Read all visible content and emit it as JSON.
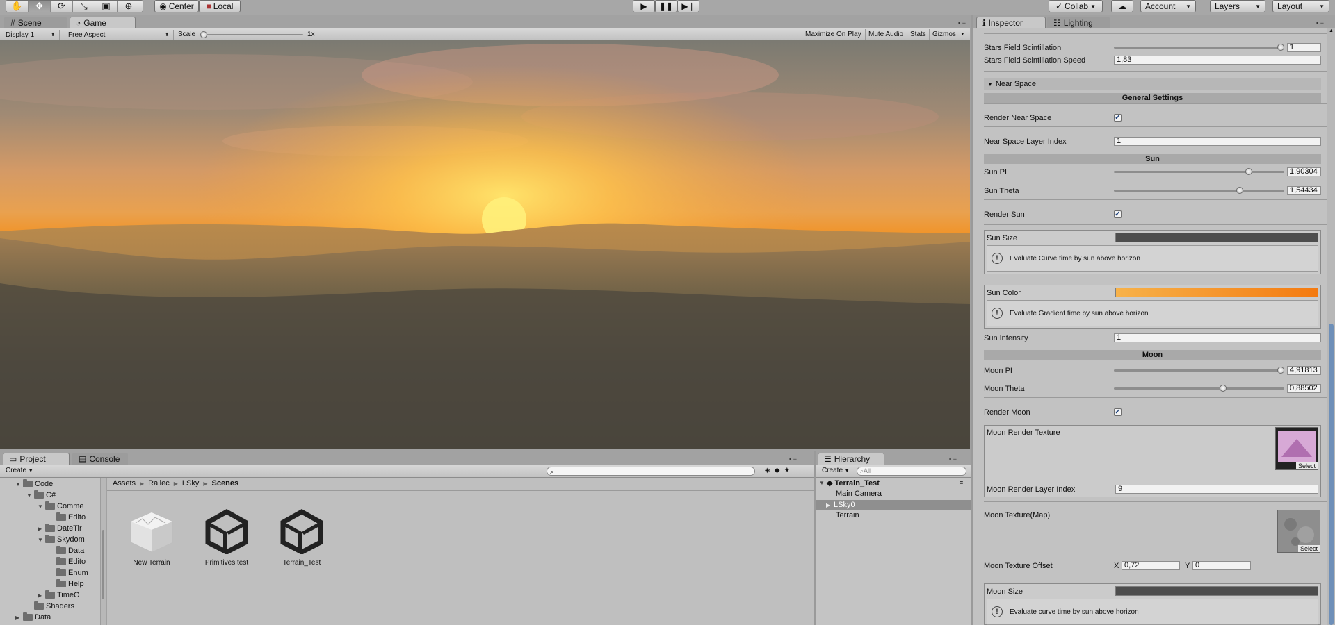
{
  "toolbar": {
    "tools": [
      "hand-icon",
      "move-icon",
      "rotate-icon",
      "scale-icon",
      "rect-icon",
      "transform-icon"
    ],
    "pivot_label": "Center",
    "space_label": "Local",
    "collab_label": "Collab",
    "account_label": "Account",
    "layers_label": "Layers",
    "layout_label": "Layout"
  },
  "view_tabs": {
    "scene": "Scene",
    "game": "Game"
  },
  "game_bar": {
    "display": "Display 1",
    "aspect": "Free Aspect",
    "scale_label": "Scale",
    "scale_value": "1x",
    "maximize": "Maximize On Play",
    "mute": "Mute Audio",
    "stats": "Stats",
    "gizmos": "Gizmos"
  },
  "project": {
    "tab_project": "Project",
    "tab_console": "Console",
    "create": "Create",
    "tree": [
      {
        "label": "Code",
        "indent": 1,
        "arrow": "open"
      },
      {
        "label": "C#",
        "indent": 2,
        "arrow": "open"
      },
      {
        "label": "Comme",
        "indent": 3,
        "arrow": "open"
      },
      {
        "label": "Edito",
        "indent": 4,
        "arrow": ""
      },
      {
        "label": "DateTir",
        "indent": 3,
        "arrow": "closed"
      },
      {
        "label": "Skydom",
        "indent": 3,
        "arrow": "open"
      },
      {
        "label": "Data",
        "indent": 4,
        "arrow": ""
      },
      {
        "label": "Edito",
        "indent": 4,
        "arrow": ""
      },
      {
        "label": "Enum",
        "indent": 4,
        "arrow": ""
      },
      {
        "label": "Help",
        "indent": 4,
        "arrow": ""
      },
      {
        "label": "TimeO",
        "indent": 3,
        "arrow": "closed"
      },
      {
        "label": "Shaders",
        "indent": 2,
        "arrow": ""
      },
      {
        "label": "Data",
        "indent": 1,
        "arrow": "closed"
      }
    ],
    "breadcrumb": [
      "Assets",
      "Rallec",
      "LSky",
      "Scenes"
    ],
    "assets": [
      {
        "name": "New Terrain",
        "icon": "terrain-icon"
      },
      {
        "name": "Primitives test",
        "icon": "unity-scene-icon"
      },
      {
        "name": "Terrain_Test",
        "icon": "unity-scene-icon"
      }
    ]
  },
  "hierarchy": {
    "tab": "Hierarchy",
    "create": "Create",
    "search_placeholder": "All",
    "scene": "Terrain_Test",
    "items": [
      "Main Camera",
      "LSky0",
      "Terrain"
    ]
  },
  "inspector": {
    "tab_inspector": "Inspector",
    "tab_lighting": "Lighting",
    "stars_scintillation": {
      "label": "Stars Field Scintillation",
      "value": "1",
      "fraction": 1.0
    },
    "stars_scintillation_speed": {
      "label": "Stars Field Scintillation Speed",
      "value": "1,83"
    },
    "near_space_foldout": "Near Space",
    "general_settings": "General Settings",
    "render_near_space": "Render Near Space",
    "near_space_layer": {
      "label": "Near Space Layer Index",
      "value": "1"
    },
    "sun_header": "Sun",
    "sun_pi": {
      "label": "Sun PI",
      "value": "1,90304",
      "fraction": 0.79
    },
    "sun_theta": {
      "label": "Sun Theta",
      "value": "1,54434",
      "fraction": 0.74
    },
    "render_sun": "Render Sun",
    "sun_size": "Sun Size",
    "sun_size_help": "Evaluate Curve time by sun above horizon",
    "sun_color": "Sun Color",
    "sun_color_help": "Evaluate Gradient time by sun above horizon",
    "sun_intensity": {
      "label": "Sun Intensity",
      "value": "1"
    },
    "moon_header": "Moon",
    "moon_pi": {
      "label": "Moon PI",
      "value": "4,91813",
      "fraction": 0.98
    },
    "moon_theta": {
      "label": "Moon Theta",
      "value": "0,88502",
      "fraction": 0.64
    },
    "render_moon": "Render Moon",
    "moon_render_texture": "Moon Render Texture",
    "select": "Select",
    "moon_render_layer": {
      "label": "Moon Render Layer Index",
      "value": "9"
    },
    "moon_texture": "Moon Texture(Map)",
    "moon_texture_offset": {
      "label": "Moon Texture Offset",
      "x_label": "X",
      "x": "0,72",
      "y_label": "Y",
      "y": "0"
    },
    "moon_size": "Moon Size",
    "moon_size_help": "Evaluate curve time by sun above horizon"
  },
  "colors": {
    "sun_gradient_start": "#f7b24a",
    "sun_gradient_end": "#f47a10"
  }
}
